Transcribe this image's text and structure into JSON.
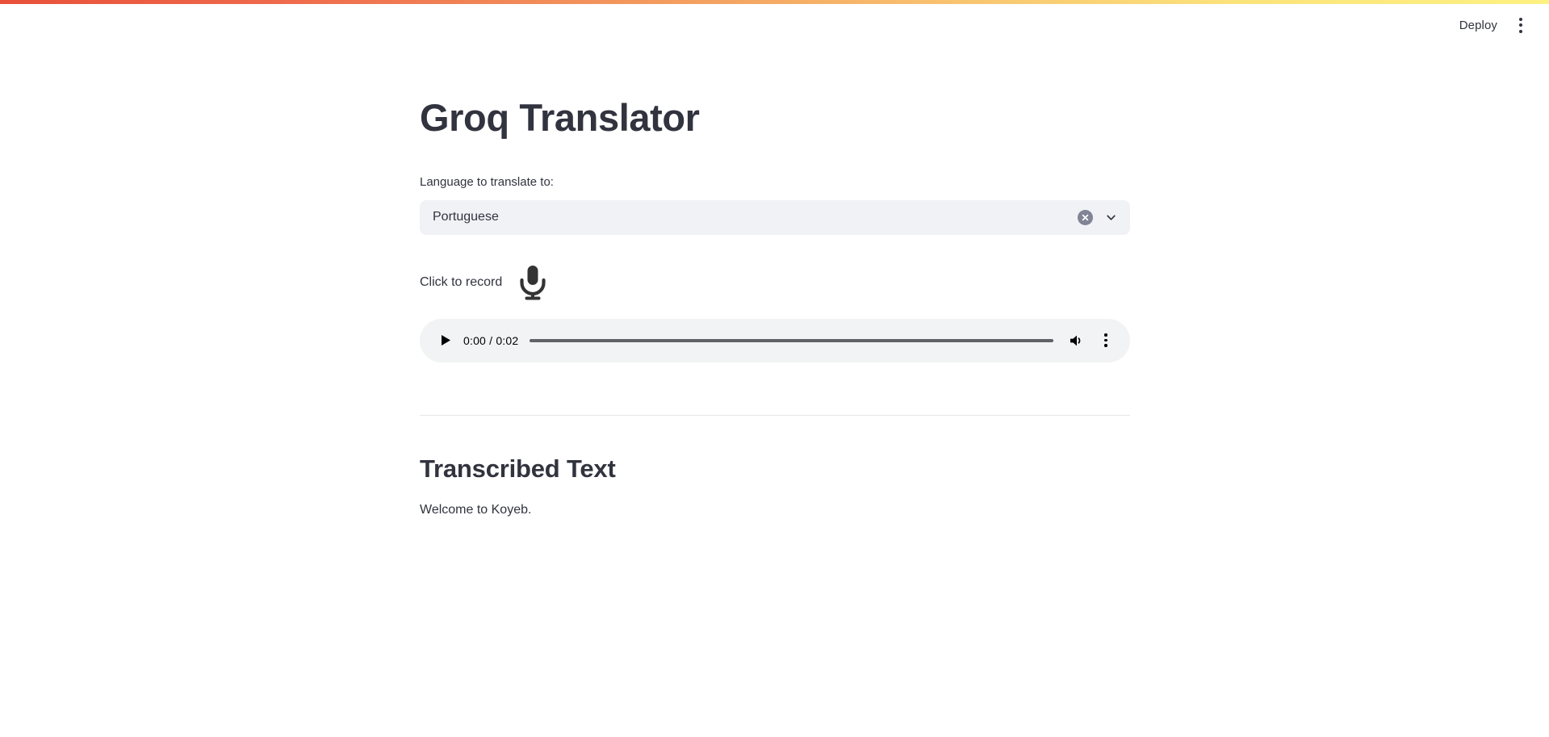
{
  "topbar": {
    "gradient_start": "#e8503a",
    "gradient_end": "#fdf181"
  },
  "header": {
    "deploy_label": "Deploy",
    "menu_icon": "kebab-menu-icon"
  },
  "app": {
    "title": "Groq Translator"
  },
  "language_selector": {
    "label": "Language to translate to:",
    "selected_value": "Portuguese",
    "clear_icon": "clear-circle-icon",
    "dropdown_icon": "chevron-down-icon",
    "background": "#f0f2f6"
  },
  "recorder": {
    "label": "Click to record",
    "icon": "microphone-icon"
  },
  "audio_player": {
    "play_icon": "play-icon",
    "time_display": "0:00 / 0:02",
    "current_time": "0:00",
    "duration": "0:02",
    "progress_percent": 0,
    "volume_icon": "volume-icon",
    "menu_icon": "kebab-menu-icon",
    "background": "#f1f3f4"
  },
  "transcription": {
    "heading": "Transcribed Text",
    "text": "Welcome to Koyeb."
  },
  "theme": {
    "text_color": "#31333e",
    "page_background": "#ffffff",
    "divider_color": "#e4e6eb"
  }
}
